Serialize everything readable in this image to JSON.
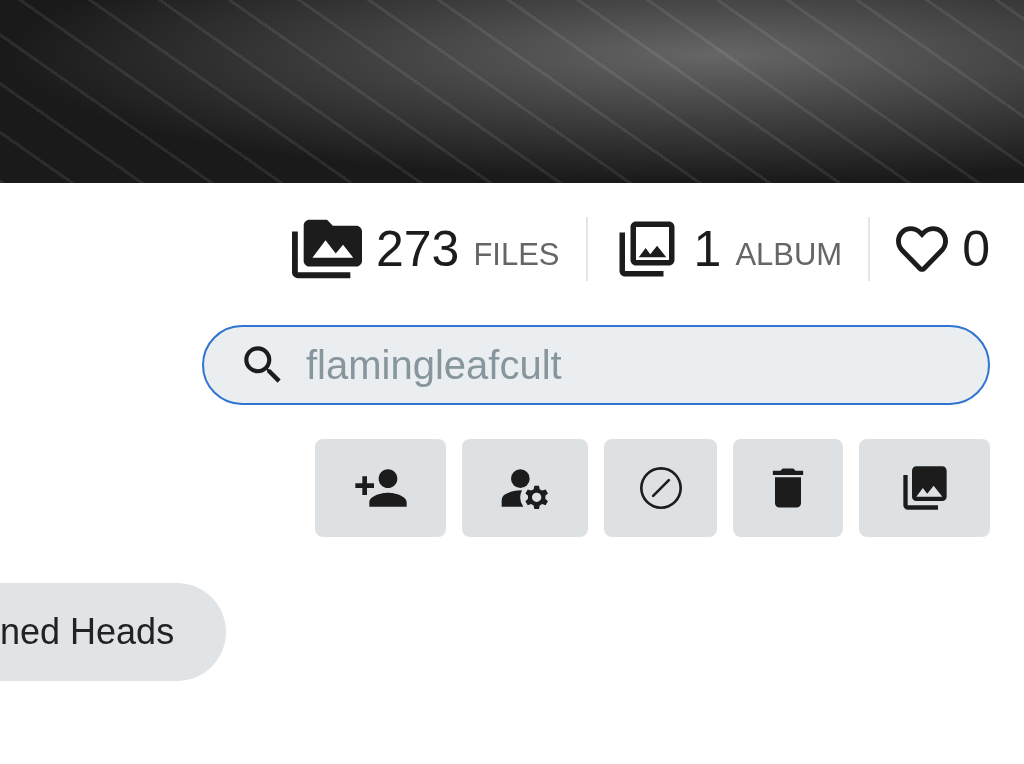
{
  "stats": [
    {
      "kind": "files",
      "count": "273",
      "label": "FILES"
    },
    {
      "kind": "album",
      "count": "1",
      "label": "ALBUM"
    },
    {
      "kind": "likes",
      "count": "0"
    }
  ],
  "search": {
    "placeholder": "flamingleafcult"
  },
  "actions": [
    {
      "kind": "follow"
    },
    {
      "kind": "manage"
    },
    {
      "kind": "block"
    },
    {
      "kind": "delete"
    },
    {
      "kind": "albums"
    }
  ],
  "tags": [
    {
      "label": "ned Heads"
    }
  ]
}
